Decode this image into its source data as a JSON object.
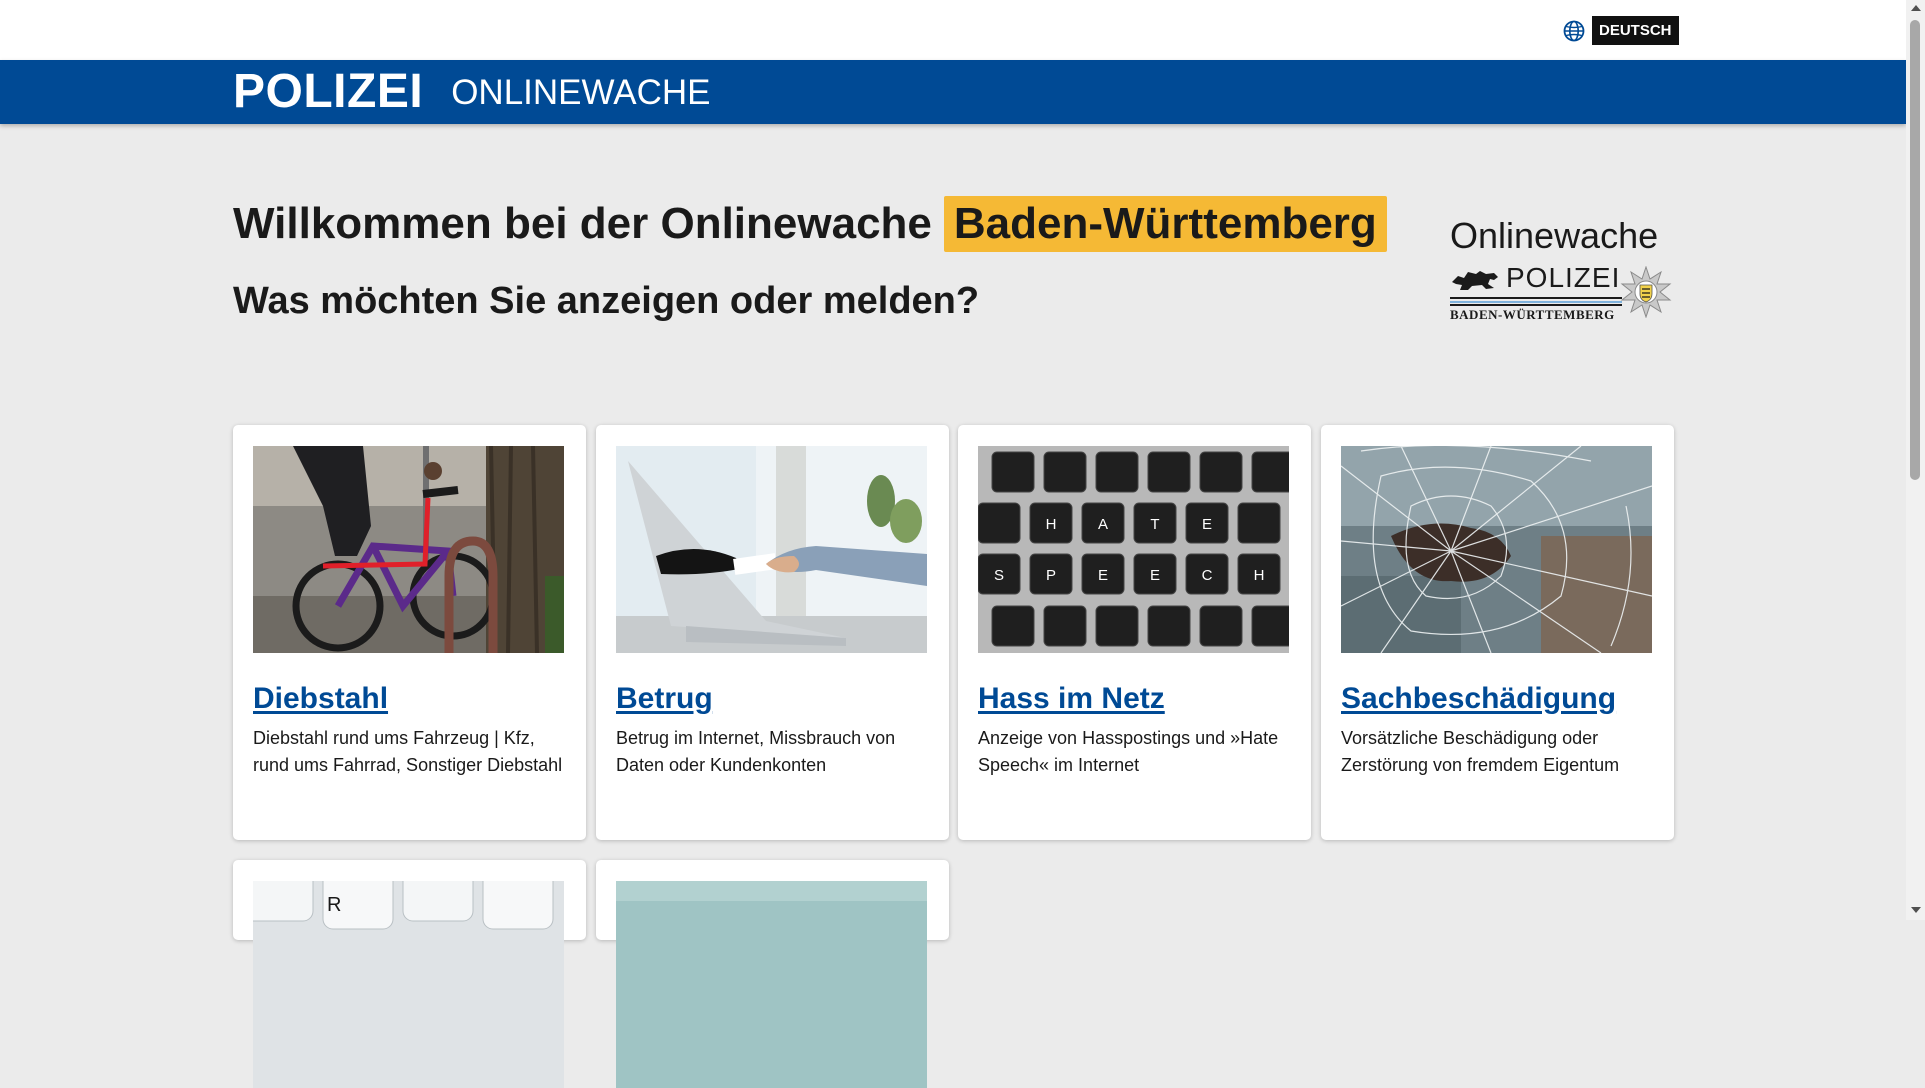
{
  "top_bar": {
    "language": "DEUTSCH",
    "language_icon": "globe-icon"
  },
  "header": {
    "brand": "POLIZEI",
    "subtitle": "ONLINEWACHE",
    "accent_color": "#004a95"
  },
  "welcome": {
    "title_prefix": "Willkommen bei der Onlinewache",
    "title_highlight": "Baden-Württemberg",
    "highlight_color": "#f5b935",
    "question": "Was möchten Sie anzeigen oder melden?"
  },
  "logo": {
    "title": "Onlinewache",
    "polizei": "POLIZEI",
    "state": "BADEN-WÜRTTEMBERG"
  },
  "cards": [
    {
      "title": "Diebstahl",
      "description": "Diebstahl rund ums Fahrzeug | Kfz, rund ums Fahrrad, Sonstiger Diebstahl"
    },
    {
      "title": "Betrug",
      "description": "Betrug im Internet, Missbrauch von Daten oder Kundenkonten"
    },
    {
      "title": "Hass im Netz",
      "description": "Anzeige von Hasspostings und »Hate Speech« im Internet"
    },
    {
      "title": "Sachbeschädigung",
      "description": "Vorsätzliche Beschädigung oder Zerstörung von fremdem Eigentum"
    }
  ],
  "keyboard_letters": {
    "row1": [
      "H",
      "A",
      "T",
      "E"
    ],
    "row2": [
      "S",
      "P",
      "E",
      "E",
      "C",
      "H"
    ],
    "partial_key": "R"
  }
}
